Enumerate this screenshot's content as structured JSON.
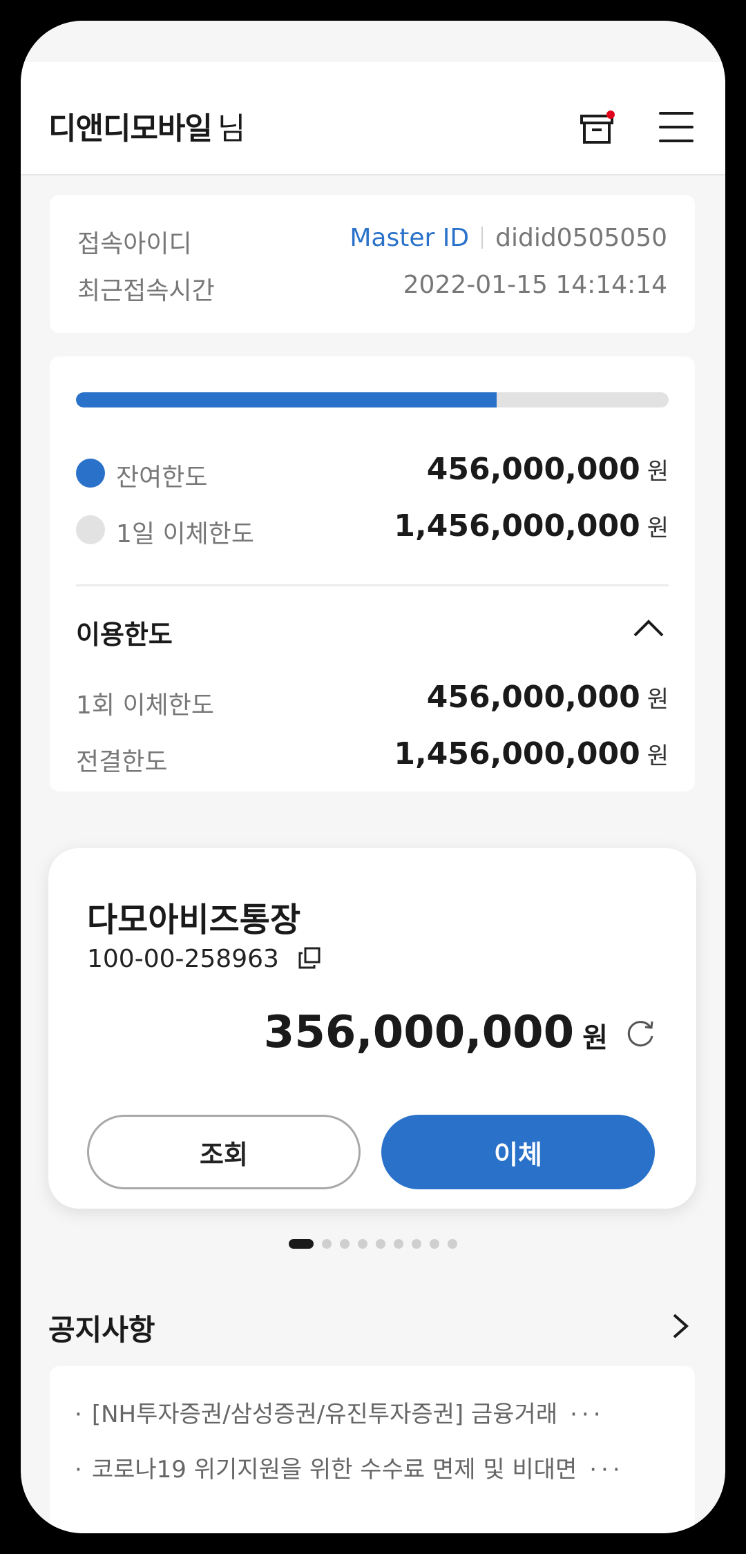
{
  "header": {
    "title": "디앤디모바일",
    "title_suffix": "님"
  },
  "login_info": {
    "id_label": "접속아이디",
    "id_type": "Master ID",
    "id_value": "didid0505050",
    "last_login_label": "최근접속시간",
    "last_login_value": "2022-01-15 14:14:14"
  },
  "limits": {
    "remaining_fraction": 0.71,
    "remaining_label": "잔여한도",
    "remaining_amount": "456,000,000",
    "daily_label": "1일 이체한도",
    "daily_amount": "1,456,000,000",
    "unit": "원",
    "section_label": "이용한도",
    "per_transfer_label": "1회 이체한도",
    "per_transfer_amount": "456,000,000",
    "approval_label": "전결한도",
    "approval_amount": "1,456,000,000",
    "colors": {
      "remaining": "#2a72c9",
      "daily": "#e2e2e2"
    }
  },
  "account": {
    "name": "다모아비즈통장",
    "number": "100-00-258963",
    "balance": "356,000,000",
    "unit": "원",
    "inquiry_button": "조회",
    "transfer_button": "이체"
  },
  "pager": {
    "total": 9,
    "active": 1
  },
  "notices": {
    "title": "공지사항",
    "items": [
      "[NH투자증권/삼성증권/유진투자증권] 금융거래",
      "코로나19 위기지원을 위한 수수료 면제 및 비대면"
    ],
    "bullet": "·",
    "more": "···"
  }
}
